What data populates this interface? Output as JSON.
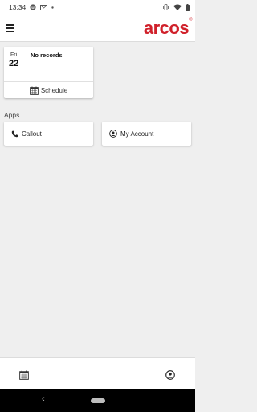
{
  "status_bar": {
    "time": "13:34",
    "left_icons": [
      "spotify-icon",
      "mail-icon",
      "dot-icon"
    ],
    "right_icons": [
      "vibrate-icon",
      "wifi-icon",
      "battery-icon"
    ]
  },
  "header": {
    "logo_text": "arcos",
    "logo_mark": "®",
    "brand_color": "#d0202a"
  },
  "schedule_card": {
    "day_name": "Fri",
    "day_number": "22",
    "message": "No records",
    "button_label": "Schedule"
  },
  "apps": {
    "section_label": "Apps",
    "items": [
      {
        "label": "Callout",
        "icon": "phone-icon"
      },
      {
        "label": "My Account",
        "icon": "user-circle-icon"
      }
    ]
  },
  "bottom_nav": {
    "items": [
      {
        "icon": "calendar-icon"
      },
      {
        "icon": "user-circle-icon"
      }
    ]
  },
  "system_nav": {
    "back_glyph": "‹"
  }
}
